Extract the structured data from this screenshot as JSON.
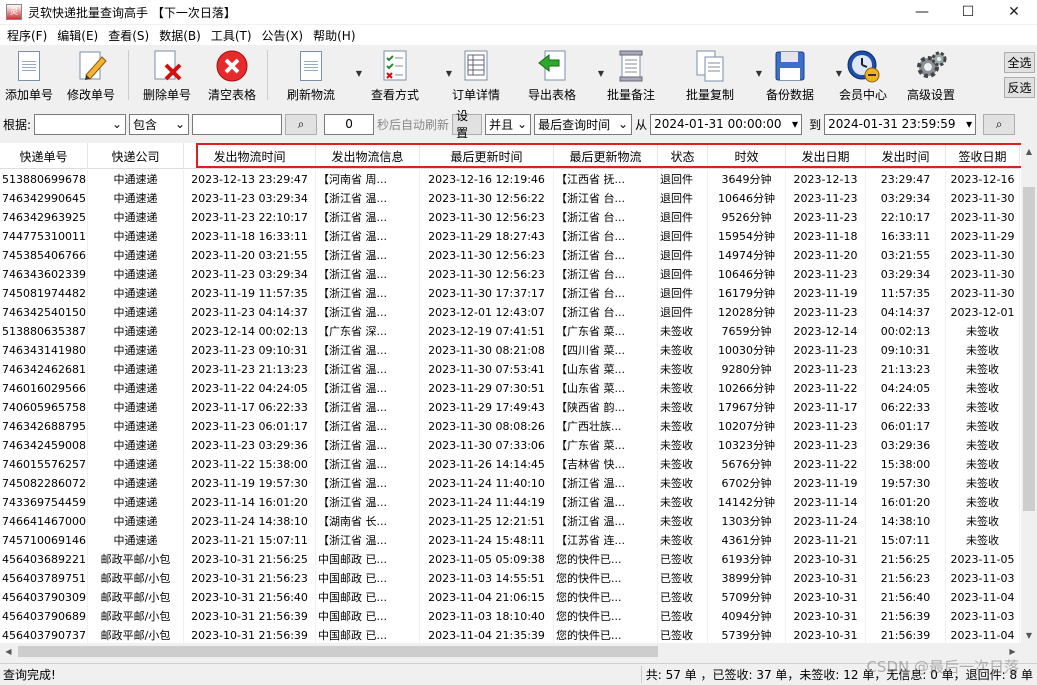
{
  "window": {
    "title": "灵软快递批量查询高手 【下一次日落】",
    "min_glyph": "—",
    "max_glyph": "☐",
    "close_glyph": "✕"
  },
  "menu": [
    "程序(F)",
    "编辑(E)",
    "查看(S)",
    "数据(B)",
    "工具(T)",
    "公告(X)",
    "帮助(H)"
  ],
  "toolbar": {
    "add": "添加单号",
    "edit": "修改单号",
    "delete": "删除单号",
    "clear": "清空表格",
    "refresh": "刷新物流",
    "view": "查看方式",
    "detail": "订单详情",
    "export": "导出表格",
    "batch_note": "批量备注",
    "batch_copy": "批量复制",
    "backup": "备份数据",
    "member": "会员中心",
    "settings": "高级设置",
    "select_all": "全选",
    "invert": "反选"
  },
  "filter": {
    "label": "根据:",
    "field_value": "",
    "op_value": "包含",
    "keyword": "",
    "seconds": "0",
    "auto_refresh_label": "秒后自动刷新",
    "set_button": "设置",
    "logic_value": "并且",
    "time_field": "最后查询时间",
    "from_label": "从",
    "from_value": "2024-01-31 00:00:00",
    "to_label": "到",
    "to_value": "2024-01-31 23:59:59"
  },
  "table": {
    "headers": [
      "快递单号",
      "快递公司",
      "发出物流时间",
      "发出物流信息",
      "最后更新时间",
      "最后更新物流",
      "状态",
      "时效",
      "发出日期",
      "发出时间",
      "签收日期"
    ],
    "rows": [
      [
        "513880699678",
        "中通速递",
        "2023-12-13 23:29:47",
        "【河南省 周...",
        "2023-12-16 12:19:46",
        "【江西省 抚...",
        "退回件",
        "3649分钟",
        "2023-12-13",
        "23:29:47",
        "2023-12-16"
      ],
      [
        "746342990645",
        "中通速递",
        "2023-11-23 03:29:34",
        "【浙江省 温...",
        "2023-11-30 12:56:22",
        "【浙江省 台...",
        "退回件",
        "10646分钟",
        "2023-11-23",
        "03:29:34",
        "2023-11-30"
      ],
      [
        "746342963925",
        "中通速递",
        "2023-11-23 22:10:17",
        "【浙江省 温...",
        "2023-11-30 12:56:23",
        "【浙江省 台...",
        "退回件",
        "9526分钟",
        "2023-11-23",
        "22:10:17",
        "2023-11-30"
      ],
      [
        "744775310011",
        "中通速递",
        "2023-11-18 16:33:11",
        "【浙江省 温...",
        "2023-11-29 18:27:43",
        "【浙江省 台...",
        "退回件",
        "15954分钟",
        "2023-11-18",
        "16:33:11",
        "2023-11-29"
      ],
      [
        "745385406766",
        "中通速递",
        "2023-11-20 03:21:55",
        "【浙江省 温...",
        "2023-11-30 12:56:23",
        "【浙江省 台...",
        "退回件",
        "14974分钟",
        "2023-11-20",
        "03:21:55",
        "2023-11-30"
      ],
      [
        "746343602339",
        "中通速递",
        "2023-11-23 03:29:34",
        "【浙江省 温...",
        "2023-11-30 12:56:23",
        "【浙江省 台...",
        "退回件",
        "10646分钟",
        "2023-11-23",
        "03:29:34",
        "2023-11-30"
      ],
      [
        "745081974482",
        "中通速递",
        "2023-11-19 11:57:35",
        "【浙江省 温...",
        "2023-11-30 17:37:17",
        "【浙江省 台...",
        "退回件",
        "16179分钟",
        "2023-11-19",
        "11:57:35",
        "2023-11-30"
      ],
      [
        "746342540150",
        "中通速递",
        "2023-11-23 04:14:37",
        "【浙江省 温...",
        "2023-12-01 12:43:07",
        "【浙江省 台...",
        "退回件",
        "12028分钟",
        "2023-11-23",
        "04:14:37",
        "2023-12-01"
      ],
      [
        "513880635387",
        "中通速递",
        "2023-12-14 00:02:13",
        "【广东省 深...",
        "2023-12-19 07:41:51",
        "【广东省 菜...",
        "未签收",
        "7659分钟",
        "2023-12-14",
        "00:02:13",
        "未签收"
      ],
      [
        "746343141980",
        "中通速递",
        "2023-11-23 09:10:31",
        "【浙江省 温...",
        "2023-11-30 08:21:08",
        "【四川省 菜...",
        "未签收",
        "10030分钟",
        "2023-11-23",
        "09:10:31",
        "未签收"
      ],
      [
        "746342462681",
        "中通速递",
        "2023-11-23 21:13:23",
        "【浙江省 温...",
        "2023-11-30 07:53:41",
        "【山东省 菜...",
        "未签收",
        "9280分钟",
        "2023-11-23",
        "21:13:23",
        "未签收"
      ],
      [
        "746016029566",
        "中通速递",
        "2023-11-22 04:24:05",
        "【浙江省 温...",
        "2023-11-29 07:30:51",
        "【山东省 菜...",
        "未签收",
        "10266分钟",
        "2023-11-22",
        "04:24:05",
        "未签收"
      ],
      [
        "740605965758",
        "中通速递",
        "2023-11-17 06:22:33",
        "【浙江省 温...",
        "2023-11-29 17:49:43",
        "【陕西省 韵...",
        "未签收",
        "17967分钟",
        "2023-11-17",
        "06:22:33",
        "未签收"
      ],
      [
        "746342688795",
        "中通速递",
        "2023-11-23 06:01:17",
        "【浙江省 温...",
        "2023-11-30 08:08:26",
        "【广西壮族...",
        "未签收",
        "10207分钟",
        "2023-11-23",
        "06:01:17",
        "未签收"
      ],
      [
        "746342459008",
        "中通速递",
        "2023-11-23 03:29:36",
        "【浙江省 温...",
        "2023-11-30 07:33:06",
        "【广东省 菜...",
        "未签收",
        "10323分钟",
        "2023-11-23",
        "03:29:36",
        "未签收"
      ],
      [
        "746015576257",
        "中通速递",
        "2023-11-22 15:38:00",
        "【浙江省 温...",
        "2023-11-26 14:14:45",
        "【吉林省 快...",
        "未签收",
        "5676分钟",
        "2023-11-22",
        "15:38:00",
        "未签收"
      ],
      [
        "745082286072",
        "中通速递",
        "2023-11-19 19:57:30",
        "【浙江省 温...",
        "2023-11-24 11:40:10",
        "【浙江省 温...",
        "未签收",
        "6702分钟",
        "2023-11-19",
        "19:57:30",
        "未签收"
      ],
      [
        "743369754459",
        "中通速递",
        "2023-11-14 16:01:20",
        "【浙江省 温...",
        "2023-11-24 11:44:19",
        "【浙江省 温...",
        "未签收",
        "14142分钟",
        "2023-11-14",
        "16:01:20",
        "未签收"
      ],
      [
        "746641467000",
        "中通速递",
        "2023-11-24 14:38:10",
        "【湖南省 长...",
        "2023-11-25 12:21:51",
        "【浙江省 温...",
        "未签收",
        "1303分钟",
        "2023-11-24",
        "14:38:10",
        "未签收"
      ],
      [
        "745710069146",
        "中通速递",
        "2023-11-21 15:07:11",
        "【浙江省 温...",
        "2023-11-24 15:48:11",
        "【江苏省 连...",
        "未签收",
        "4361分钟",
        "2023-11-21",
        "15:07:11",
        "未签收"
      ],
      [
        "456403689221",
        "邮政平邮/小包",
        "2023-10-31 21:56:25",
        "中国邮政 已...",
        "2023-11-05 05:09:38",
        "您的快件已...",
        "已签收",
        "6193分钟",
        "2023-10-31",
        "21:56:25",
        "2023-11-05"
      ],
      [
        "456403789751",
        "邮政平邮/小包",
        "2023-10-31 21:56:23",
        "中国邮政 已...",
        "2023-11-03 14:55:51",
        "您的快件已...",
        "已签收",
        "3899分钟",
        "2023-10-31",
        "21:56:23",
        "2023-11-03"
      ],
      [
        "456403790309",
        "邮政平邮/小包",
        "2023-10-31 21:56:40",
        "中国邮政 已...",
        "2023-11-04 21:06:15",
        "您的快件已...",
        "已签收",
        "5709分钟",
        "2023-10-31",
        "21:56:40",
        "2023-11-04"
      ],
      [
        "456403790689",
        "邮政平邮/小包",
        "2023-10-31 21:56:39",
        "中国邮政 已...",
        "2023-11-03 18:10:40",
        "您的快件已...",
        "已签收",
        "4094分钟",
        "2023-10-31",
        "21:56:39",
        "2023-11-03"
      ],
      [
        "456403790737",
        "邮政平邮/小包",
        "2023-10-31 21:56:39",
        "中国邮政 已...",
        "2023-11-04 21:35:39",
        "您的快件已...",
        "已签收",
        "5739分钟",
        "2023-10-31",
        "21:56:39",
        "2023-11-04"
      ]
    ]
  },
  "status": {
    "left": "查询完成!",
    "right": "共: 57 单 ，已签收: 37 单，未签收: 12 单，无信息: 0 单，退回件: 8 单"
  },
  "watermark": "CSDN @最后一次日落",
  "colors": {
    "highlight_border": "#e02020"
  }
}
